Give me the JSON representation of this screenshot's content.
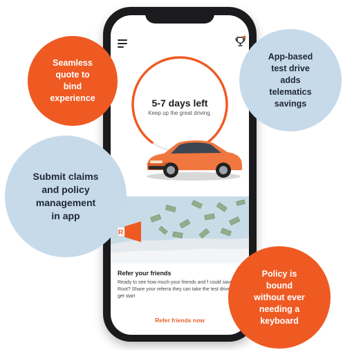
{
  "app": {
    "ring_title": "5-7 days left",
    "ring_subtitle": "Keep up the great driving.",
    "refer_title": "Refer your friends",
    "refer_body": "Ready to see how much your friends and f could save with Root? Share your referra they can take the test drive and get start",
    "refer_link": "Refer friends now",
    "icons": {
      "menu": "menu-icon",
      "trophy": "trophy-icon"
    },
    "accent_color": "#ef5a23"
  },
  "callouts": {
    "quote": "Seamless\nquote to\nbind\nexperience",
    "test_drive": "App-based\ntest drive\nadds\ntelematics\nsavings",
    "claims": "Submit claims\nand policy\nmanagement\nin app",
    "policy": "Policy is\nbound\nwithout ever\nneeding  a\nkeyboard"
  }
}
